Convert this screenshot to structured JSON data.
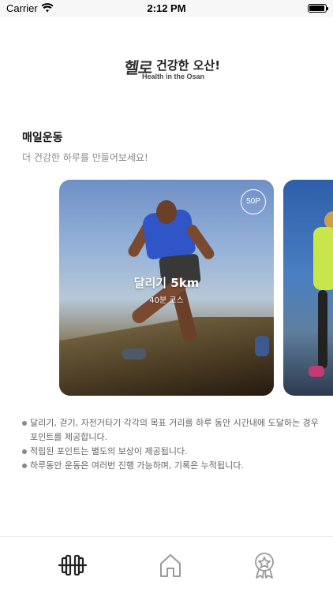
{
  "status_bar": {
    "carrier": "Carrier",
    "time": "2:12 PM"
  },
  "logo": {
    "script_text": "헬로",
    "korean_text": "건강한 오산!",
    "english_text": "Health in the Osan"
  },
  "section": {
    "title": "매일운동",
    "subtitle": "더 건강한 하루를 만들어보세요!"
  },
  "cards": [
    {
      "title": "달리기 5km",
      "subtitle": "40분 코스",
      "badge": "50P"
    }
  ],
  "notes": [
    "달리기, 걷기, 자전거타기 각각의 목표 거리를 하루 동안 시간내에 도달하는 경우 포인트를 제공합니다.",
    "적립된 포인트는 별도의 보상이 제공됩니다.",
    "하루동안 운동은 여러번 진행 가능하며, 기록은 누적됩니다."
  ],
  "tab_bar": {
    "tabs": [
      {
        "icon": "dumbbell-icon",
        "active": true
      },
      {
        "icon": "home-icon",
        "active": false
      },
      {
        "icon": "award-icon",
        "active": false
      }
    ]
  },
  "colors": {
    "active_icon": "#222222",
    "inactive_icon": "#9a9a9a",
    "subtitle": "#888888"
  }
}
